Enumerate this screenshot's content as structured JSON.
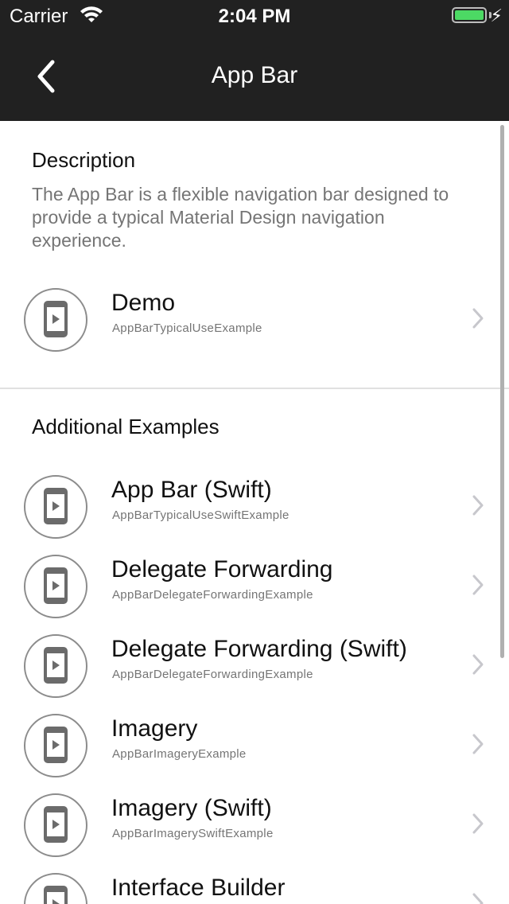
{
  "status_bar": {
    "carrier": "Carrier",
    "time": "2:04 PM"
  },
  "app_bar": {
    "title": "App Bar",
    "background_color": "#212121"
  },
  "description": {
    "heading": "Description",
    "text": "The App Bar is a flexible navigation bar designed to provide a typical Material Design navigation experience."
  },
  "demo": {
    "title": "Demo",
    "subtitle": "AppBarTypicalUseExample"
  },
  "additional": {
    "heading": "Additional Examples",
    "items": [
      {
        "title": "App Bar (Swift)",
        "subtitle": "AppBarTypicalUseSwiftExample"
      },
      {
        "title": "Delegate Forwarding",
        "subtitle": "AppBarDelegateForwardingExample"
      },
      {
        "title": "Delegate Forwarding (Swift)",
        "subtitle": "AppBarDelegateForwardingExample"
      },
      {
        "title": "Imagery",
        "subtitle": "AppBarImageryExample"
      },
      {
        "title": "Imagery (Swift)",
        "subtitle": "AppBarImagerySwiftExample"
      },
      {
        "title": "Interface Builder",
        "subtitle": ""
      }
    ]
  },
  "icons": {
    "back": "chevron-left-icon",
    "row": "phone-play-icon",
    "disclosure": "chevron-right-icon"
  }
}
